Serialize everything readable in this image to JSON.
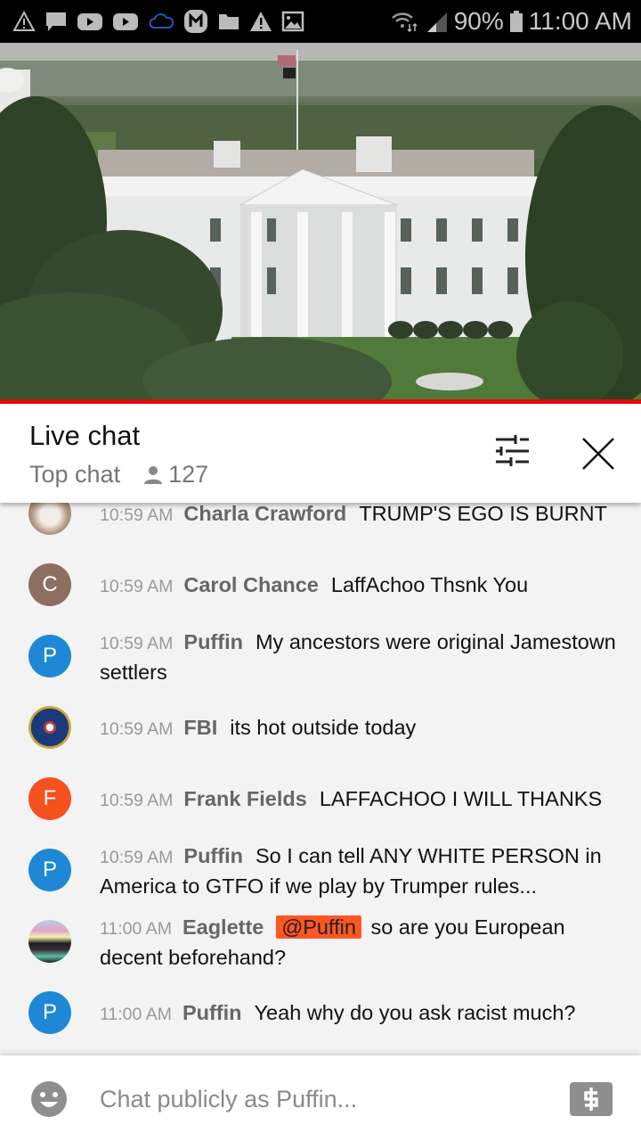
{
  "status_bar": {
    "notification_icons": [
      "warning-icon",
      "message-icon",
      "youtube-icon",
      "youtube-icon",
      "cloud-icon",
      "m-app-icon",
      "folder-icon",
      "alert-icon",
      "image-icon"
    ],
    "battery": "90%",
    "time": "11:00 AM"
  },
  "video": {
    "description": "Live stream of the White House north facade",
    "progress_percent": 100
  },
  "header": {
    "title": "Live chat",
    "mode": "Top chat",
    "viewer_count": "127"
  },
  "messages": [
    {
      "time": "10:59 AM",
      "author": "Charla Crawford",
      "text": "TRUMP'S EGO IS BURNT",
      "avatar": {
        "type": "photo"
      }
    },
    {
      "time": "10:59 AM",
      "author": "Carol Chance",
      "text": "LaffAchoo Thsnk You",
      "avatar": {
        "type": "letter",
        "letter": "C",
        "color": "#8d6e63"
      }
    },
    {
      "time": "10:59 AM",
      "author": "Puffin",
      "text": "My ancestors were original Jamestown settlers",
      "avatar": {
        "type": "letter",
        "letter": "P",
        "color": "#1e88d6"
      }
    },
    {
      "time": "10:59 AM",
      "author": "FBI",
      "text": "its hot outside today",
      "avatar": {
        "type": "seal"
      }
    },
    {
      "time": "10:59 AM",
      "author": "Frank Fields",
      "text": "LAFFACHOO I WILL THANKS",
      "avatar": {
        "type": "letter",
        "letter": "F",
        "color": "#f4511e"
      }
    },
    {
      "time": "10:59 AM",
      "author": "Puffin",
      "text": "So I can tell ANY WHITE PERSON in America to GTFO if we play by Trumper rules...",
      "avatar": {
        "type": "letter",
        "letter": "P",
        "color": "#1e88d6"
      }
    },
    {
      "time": "11:00 AM",
      "author": "Eaglette",
      "mention": "@Puffin",
      "text": "so are you European decent beforehand?",
      "avatar": {
        "type": "photo"
      }
    },
    {
      "time": "11:00 AM",
      "author": "Puffin",
      "text": "Yeah why do you ask racist much?",
      "avatar": {
        "type": "letter",
        "letter": "P",
        "color": "#1e88d6"
      }
    }
  ],
  "input": {
    "placeholder": "Chat publicly as Puffin...",
    "value": ""
  },
  "colors": {
    "progress": "#e10d0d",
    "mention_bg": "#ff5722"
  }
}
